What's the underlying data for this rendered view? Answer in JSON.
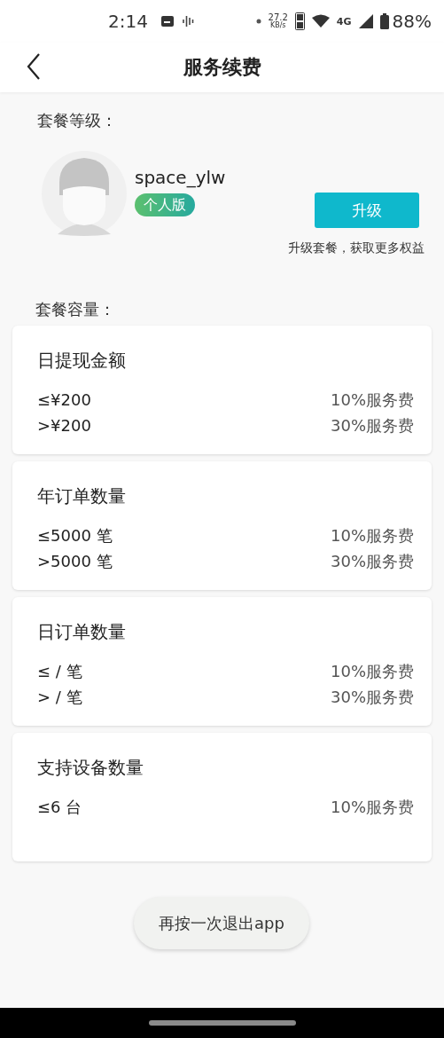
{
  "status_bar": {
    "time": "2:14",
    "speed": "27.2",
    "speed_unit": "KB/s",
    "network": "4G",
    "battery": "88%"
  },
  "header": {
    "title": "服务续费"
  },
  "plan_level": {
    "label": "套餐等级：",
    "username": "space_ylw",
    "tier": "个人版",
    "upgrade_button": "升级",
    "upgrade_hint": "升级套餐，获取更多权益"
  },
  "capacity": {
    "label": "套餐容量：",
    "cards": [
      {
        "title": "日提现金额",
        "rows": [
          {
            "limit": "≤¥200",
            "fee": "10%服务费"
          },
          {
            "limit": ">¥200",
            "fee": "30%服务费"
          }
        ]
      },
      {
        "title": "年订单数量",
        "rows": [
          {
            "limit": "≤5000 笔",
            "fee": "10%服务费"
          },
          {
            "limit": ">5000 笔",
            "fee": "30%服务费"
          }
        ]
      },
      {
        "title": "日订单数量",
        "rows": [
          {
            "limit": "≤ / 笔",
            "fee": "10%服务费"
          },
          {
            "limit": "> / 笔",
            "fee": "30%服务费"
          }
        ]
      },
      {
        "title": "支持设备数量",
        "rows": [
          {
            "limit": "≤6 台",
            "fee": "10%服务费"
          }
        ]
      }
    ]
  },
  "toast": "再按一次退出app"
}
